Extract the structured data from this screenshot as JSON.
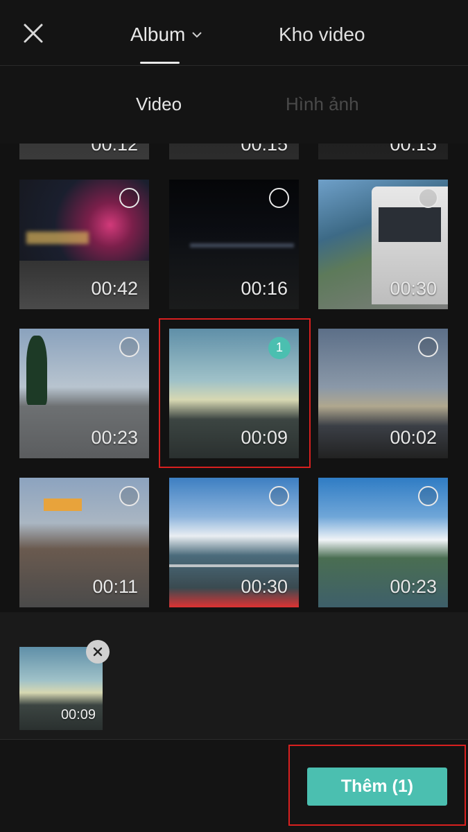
{
  "header": {
    "close_icon": "close-icon",
    "album_tab": "Album",
    "album_chevron_icon": "chevron-down-icon",
    "library_tab": "Kho video"
  },
  "subtabs": {
    "video": "Video",
    "images": "Hình ảnh"
  },
  "grid": {
    "top_row_partial": [
      "00:12",
      "00:15",
      "00:15"
    ],
    "items": [
      {
        "duration": "00:42",
        "selected": false
      },
      {
        "duration": "00:16",
        "selected": false
      },
      {
        "duration": "00:30",
        "selected": false
      },
      {
        "duration": "00:23",
        "selected": false
      },
      {
        "duration": "00:09",
        "selected": true,
        "selection_number": "1"
      },
      {
        "duration": "00:02",
        "selected": false
      },
      {
        "duration": "00:11",
        "selected": false
      },
      {
        "duration": "00:30",
        "selected": false
      },
      {
        "duration": "00:23",
        "selected": false
      }
    ]
  },
  "tray": {
    "selected_duration": "00:09",
    "remove_icon": "close-icon"
  },
  "footer": {
    "add_button": "Thêm (1)"
  },
  "colors": {
    "accent": "#4bbfb0",
    "highlight": "#d9201f",
    "background": "#121212"
  }
}
